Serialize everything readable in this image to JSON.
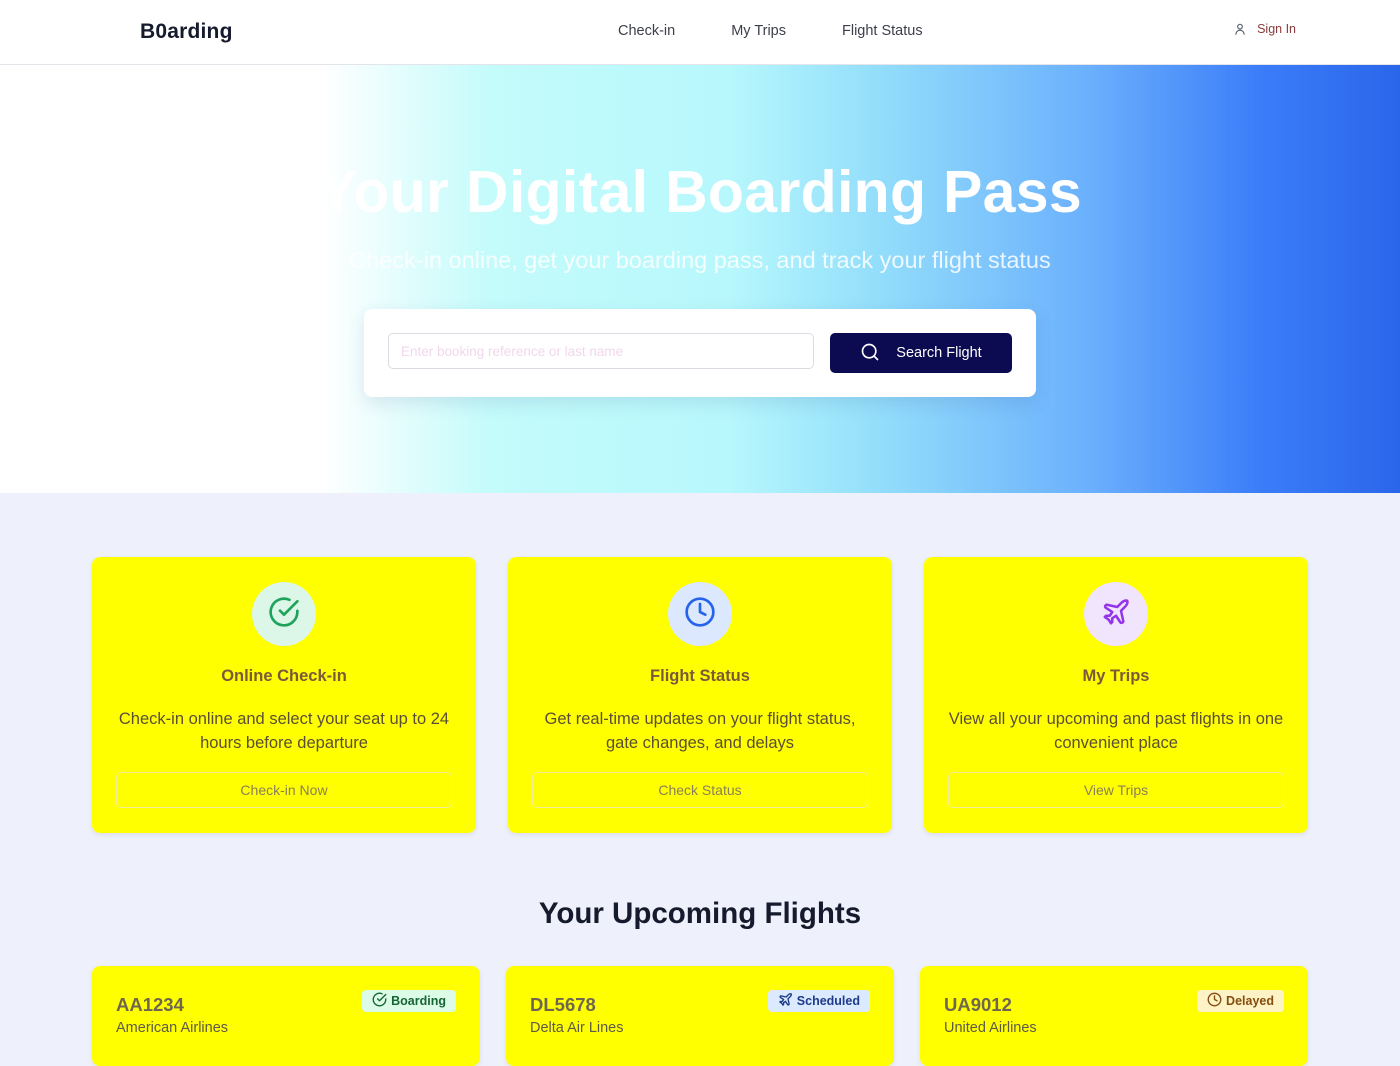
{
  "header": {
    "logo": "B0arding",
    "nav": [
      {
        "label": "Check-in"
      },
      {
        "label": "My Trips"
      },
      {
        "label": "Flight Status"
      }
    ],
    "signin_label": "Sign In",
    "signin_icon": "user-icon"
  },
  "hero": {
    "title": "Your Digital Boarding Pass",
    "subtitle": "Check-in online, get your boarding pass, and track your flight status",
    "search": {
      "placeholder": "Enter booking reference or last name",
      "value": "",
      "button_label": "Search Flight",
      "button_icon": "search-icon"
    }
  },
  "features": [
    {
      "icon": "check-circle-icon",
      "icon_color": "#1fa35a",
      "icon_bg": "#dcf7e8",
      "title": "Online Check-in",
      "description": "Check-in online and select your seat up to 24 hours before departure",
      "button_label": "Check-in Now"
    },
    {
      "icon": "clock-icon",
      "icon_color": "#2563eb",
      "icon_bg": "#dbe8fd",
      "title": "Flight Status",
      "description": "Get real-time updates on your flight status, gate changes, and delays",
      "button_label": "Check Status"
    },
    {
      "icon": "plane-icon",
      "icon_color": "#9333ea",
      "icon_bg": "#f1e4fd",
      "title": "My Trips",
      "description": "View all your upcoming and past flights in one convenient place",
      "button_label": "View Trips"
    }
  ],
  "upcoming": {
    "title": "Your Upcoming Flights",
    "flights": [
      {
        "number": "AA1234",
        "airline": "American Airlines",
        "status": "Boarding",
        "status_icon": "check-circle-icon",
        "status_color": "#166534",
        "status_bg": "#dcfce7"
      },
      {
        "number": "DL5678",
        "airline": "Delta Air Lines",
        "status": "Scheduled",
        "status_icon": "plane-icon",
        "status_color": "#1e3a8a",
        "status_bg": "#dbeafe"
      },
      {
        "number": "UA9012",
        "airline": "United Airlines",
        "status": "Delayed",
        "status_icon": "clock-icon",
        "status_color": "#854d0e",
        "status_bg": "#fef3c7"
      }
    ]
  }
}
